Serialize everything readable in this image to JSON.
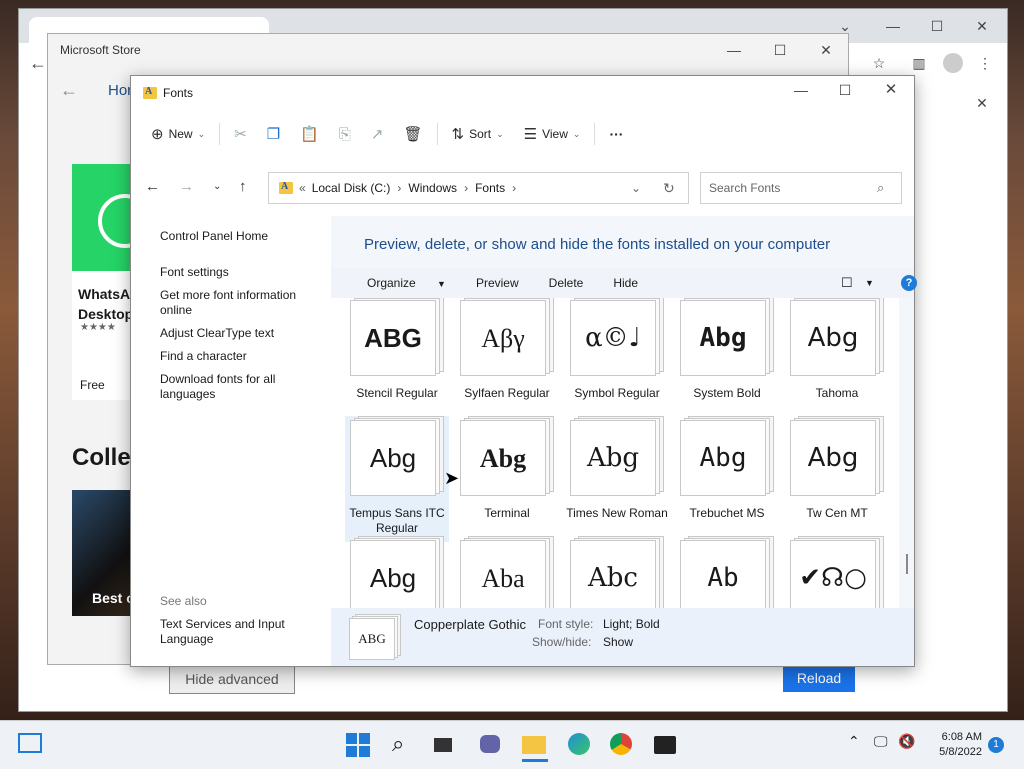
{
  "chrome": {
    "hide_advanced": "Hide advanced",
    "reload": "Reload"
  },
  "store": {
    "title": "Microsoft Store",
    "nav_home": "Hor",
    "app_name": "WhatsA Desktop",
    "price": "Free",
    "collections": "Collec",
    "best": "Best o"
  },
  "explorer": {
    "title": "Fonts",
    "cmd": {
      "new": "New",
      "sort": "Sort",
      "view": "View",
      "more": "···"
    },
    "address": {
      "prefix": "«",
      "parts": [
        "Local Disk (C:)",
        "Windows",
        "Fonts"
      ]
    },
    "search_placeholder": "Search Fonts",
    "left": {
      "control_panel_home": "Control Panel Home",
      "font_settings": "Font settings",
      "more_info": "Get more font information online",
      "cleartype": "Adjust ClearType text",
      "find_char": "Find a character",
      "download": "Download fonts for all languages",
      "see_also": "See also",
      "text_services": "Text Services and Input Language"
    },
    "heading": "Preview, delete, or show and hide the fonts installed on your computer",
    "orgbar": {
      "organize": "Organize",
      "preview": "Preview",
      "delete": "Delete",
      "hide": "Hide",
      "help": "?"
    },
    "fonts": [
      {
        "name": "Stencil Regular",
        "sample": "ABG"
      },
      {
        "name": "Sylfaen Regular",
        "sample": "Aβγ"
      },
      {
        "name": "Symbol Regular",
        "sample": "α©♩"
      },
      {
        "name": "System Bold",
        "sample": "Abg"
      },
      {
        "name": "Tahoma",
        "sample": "Abg"
      },
      {
        "name": "Tempus Sans ITC Regular",
        "sample": "Abg"
      },
      {
        "name": "Terminal",
        "sample": "Abg"
      },
      {
        "name": "Times New Roman",
        "sample": "Abg"
      },
      {
        "name": "Trebuchet MS",
        "sample": "Abg"
      },
      {
        "name": "Tw Cen MT",
        "sample": "Abg"
      },
      {
        "name": "",
        "sample": "Abg"
      },
      {
        "name": "",
        "sample": "Aba"
      },
      {
        "name": "",
        "sample": "Abc"
      },
      {
        "name": "",
        "sample": "Ab"
      },
      {
        "name": "",
        "sample": "✔☊○"
      }
    ],
    "preview": {
      "sample": "ABG",
      "name": "Copperplate Gothic",
      "style_label": "Font style:",
      "style_value": "Light; Bold",
      "showhide_label": "Show/hide:",
      "showhide_value": "Show"
    }
  },
  "taskbar": {
    "time": "6:08 AM",
    "date": "5/8/2022",
    "badge": "1"
  }
}
